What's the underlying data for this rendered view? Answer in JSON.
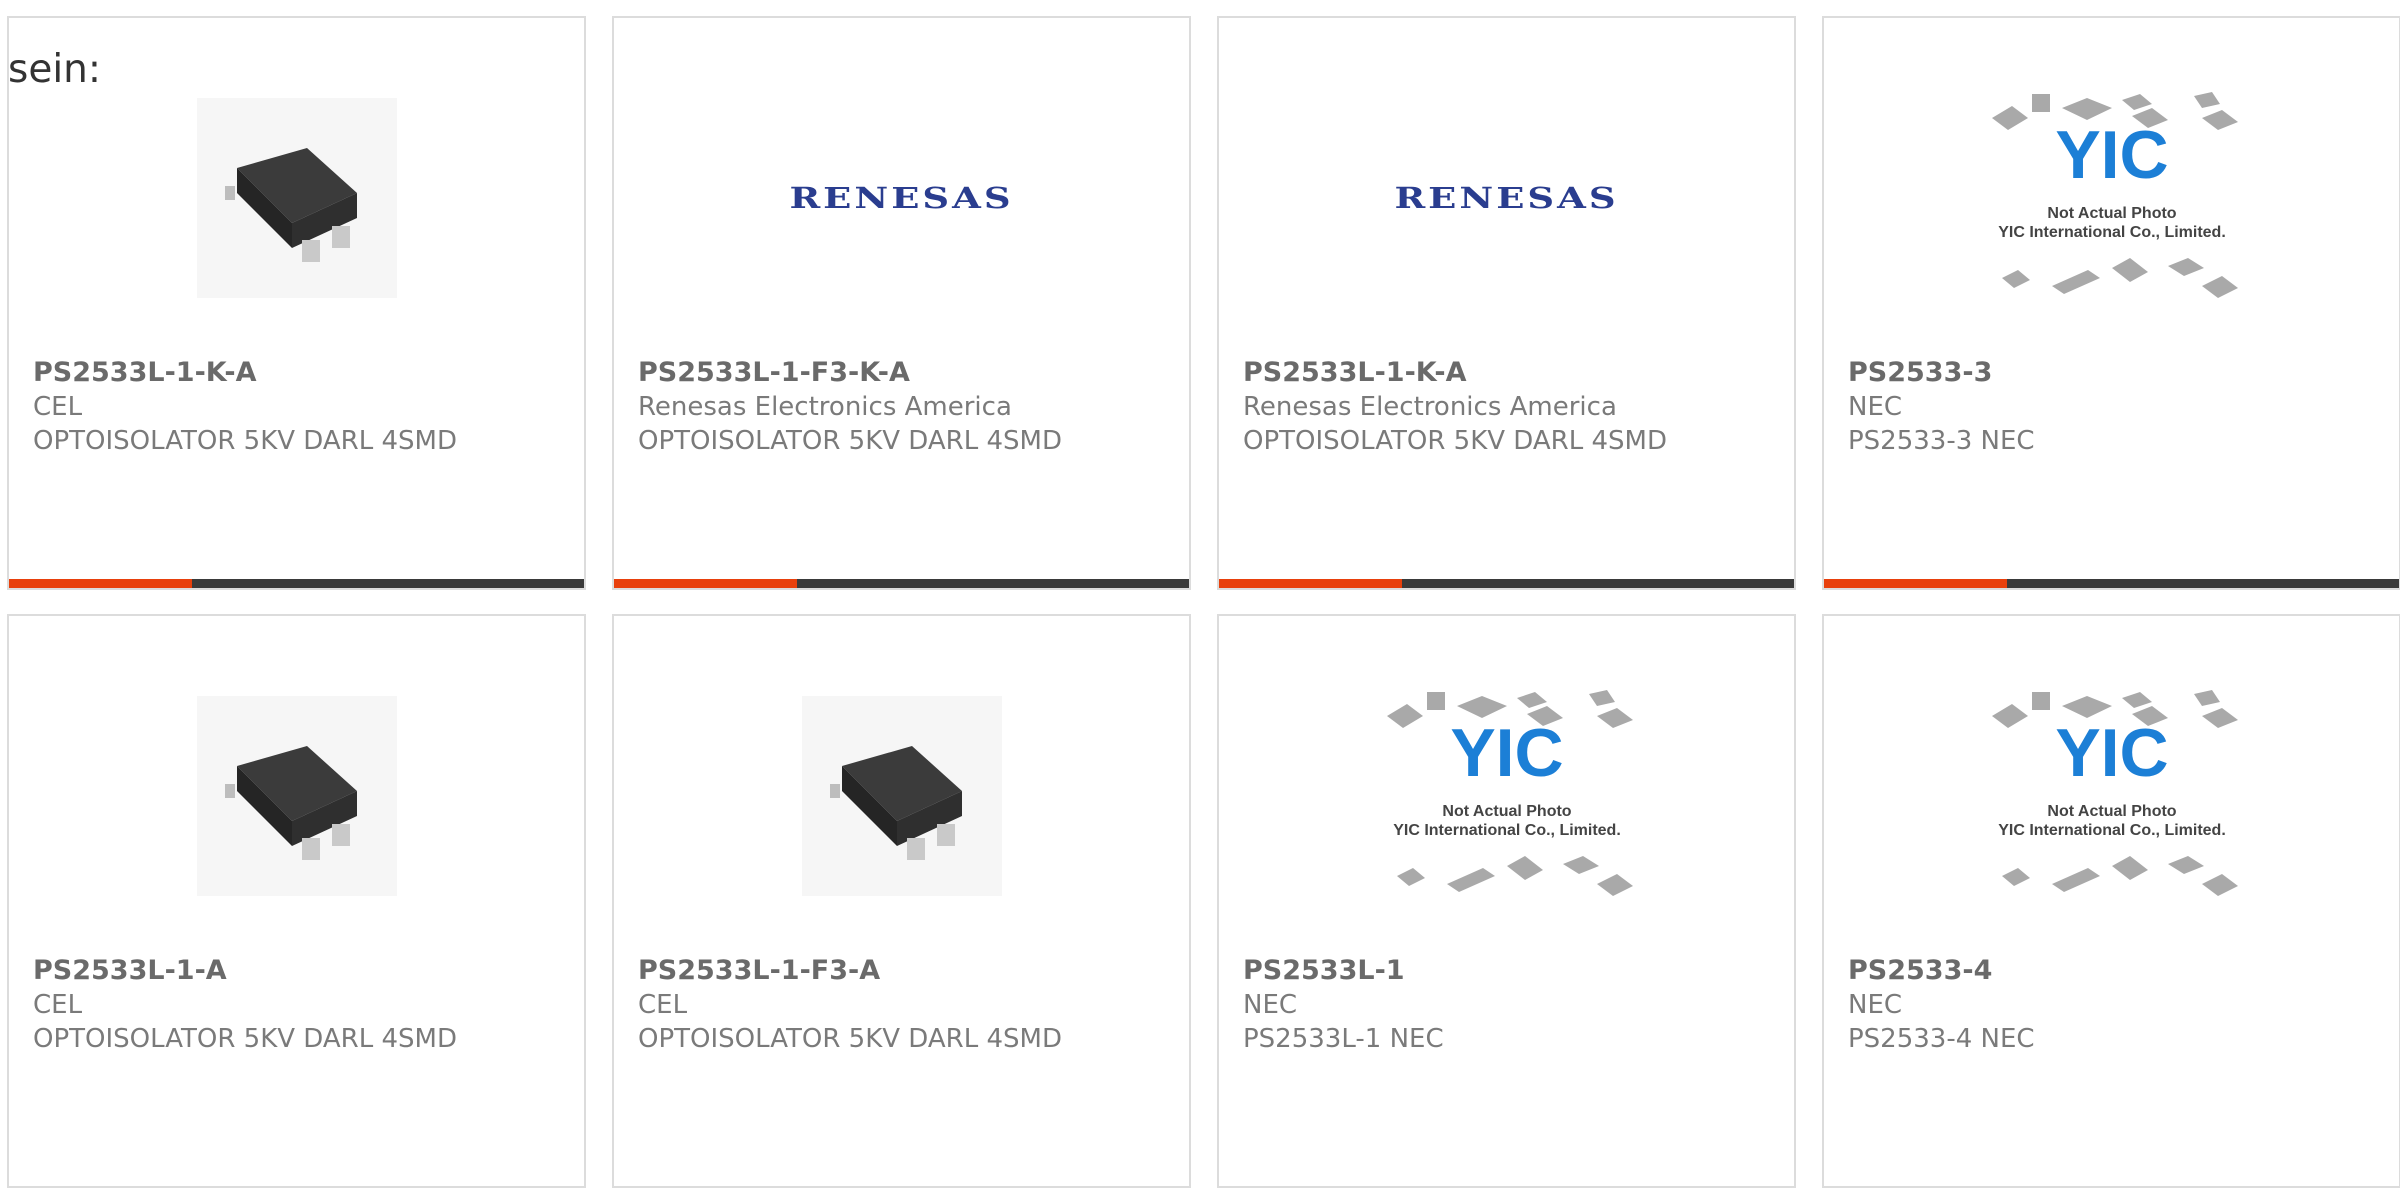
{
  "lead_text": "sein:",
  "colors": {
    "accent": "#e8400c",
    "bar": "#3a3a3a",
    "renesas": "#2a3d8f",
    "yic": "#1c7fd6"
  },
  "cards": [
    {
      "part": "PS2533L-1-K-A",
      "manufacturer": "CEL",
      "description": "OPTOISOLATOR 5KV DARL 4SMD",
      "image": "optoisolator-photo"
    },
    {
      "part": "PS2533L-1-F3-K-A",
      "manufacturer": "Renesas Electronics America",
      "description": "OPTOISOLATOR 5KV DARL 4SMD",
      "image": "renesas-logo",
      "logo_text": "RENESAS"
    },
    {
      "part": "PS2533L-1-K-A",
      "manufacturer": "Renesas Electronics America",
      "description": "OPTOISOLATOR 5KV DARL 4SMD",
      "image": "renesas-logo",
      "logo_text": "RENESAS"
    },
    {
      "part": "PS2533-3",
      "manufacturer": "NEC",
      "description": "PS2533-3 NEC",
      "image": "yic-placeholder",
      "placeholder_line1": "Not Actual Photo",
      "placeholder_line2": "YIC International Co., Limited."
    },
    {
      "part": "PS2533L-1-A",
      "manufacturer": "CEL",
      "description": "OPTOISOLATOR 5KV DARL 4SMD",
      "image": "optoisolator-photo"
    },
    {
      "part": "PS2533L-1-F3-A",
      "manufacturer": "CEL",
      "description": "OPTOISOLATOR 5KV DARL 4SMD",
      "image": "optoisolator-photo"
    },
    {
      "part": "PS2533L-1",
      "manufacturer": "NEC",
      "description": "PS2533L-1 NEC",
      "image": "yic-placeholder",
      "placeholder_line1": "Not Actual Photo",
      "placeholder_line2": "YIC International Co., Limited."
    },
    {
      "part": "PS2533-4",
      "manufacturer": "NEC",
      "description": "PS2533-4 NEC",
      "image": "yic-placeholder",
      "placeholder_line1": "Not Actual Photo",
      "placeholder_line2": "YIC International Co., Limited."
    }
  ]
}
